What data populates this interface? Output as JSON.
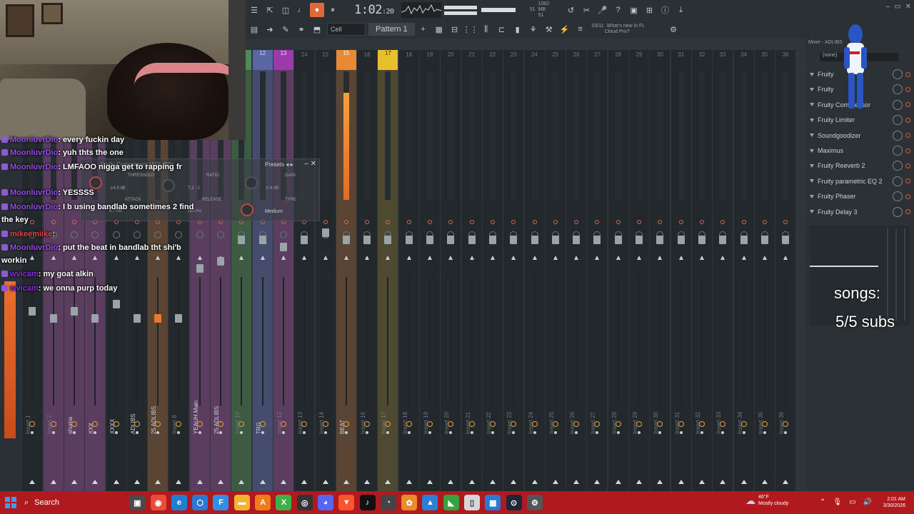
{
  "toolbar": {
    "time": "1:02",
    "time_small": ":20",
    "time_label": "M:S:CS",
    "cpu": "51",
    "ram": "1082 MB",
    "ram2": "51",
    "snap_label": "Cell",
    "pattern": "Pattern 1",
    "news": [
      "What's new in FL",
      "Cloud Pro?"
    ],
    "news_date": "03/11"
  },
  "mixer": {
    "tracks": [
      {
        "num": "",
        "name": "Master",
        "color": "dark"
      },
      {
        "num": "1",
        "name": "Insert 1",
        "color": "dark"
      },
      {
        "num": "2",
        "name": "Insert 2",
        "color": "purple"
      },
      {
        "num": "3",
        "name": "shuma",
        "color": "purple"
      },
      {
        "num": "4",
        "name": "XXX",
        "color": "purple"
      },
      {
        "num": "5",
        "name": "XXXX",
        "color": "dark"
      },
      {
        "num": "6",
        "name": "ADLIBS",
        "color": "dark"
      },
      {
        "num": "7",
        "name": "25 ADLIBS",
        "color": "orange"
      },
      {
        "num": "8",
        "name": "Insert 8",
        "color": "dark"
      },
      {
        "num": "9",
        "name": "YEAUH Main",
        "color": "purple"
      },
      {
        "num": "10",
        "name": "25 ADLIBS",
        "color": "purple"
      },
      {
        "num": "11",
        "name": "Insert 10",
        "color": "green"
      },
      {
        "num": "12",
        "name": "TRG",
        "color": "blue"
      },
      {
        "num": "13",
        "name": "Insert 12",
        "color": "purple"
      },
      {
        "num": "14",
        "name": "Insert 13",
        "color": "dark"
      },
      {
        "num": "15",
        "name": "Insert 14",
        "color": "dark"
      },
      {
        "num": "15",
        "name": "BEAT",
        "color": "orange"
      },
      {
        "num": "16",
        "name": "Insert 16",
        "color": "dark"
      },
      {
        "num": "17",
        "name": "Insert 17",
        "color": "gold"
      },
      {
        "num": "18",
        "name": "Insert 18",
        "color": "dark"
      },
      {
        "num": "19",
        "name": "Insert 19",
        "color": "dark"
      },
      {
        "num": "20",
        "name": "Insert 20",
        "color": "dark"
      },
      {
        "num": "21",
        "name": "Insert 21",
        "color": "dark"
      },
      {
        "num": "22",
        "name": "Insert 22",
        "color": "dark"
      },
      {
        "num": "23",
        "name": "Insert 23",
        "color": "dark"
      },
      {
        "num": "24",
        "name": "Insert 24",
        "color": "dark"
      },
      {
        "num": "25",
        "name": "Insert 25",
        "color": "dark"
      },
      {
        "num": "26",
        "name": "Insert 26",
        "color": "dark"
      },
      {
        "num": "27",
        "name": "Insert 27",
        "color": "dark"
      },
      {
        "num": "28",
        "name": "Insert 28",
        "color": "dark"
      },
      {
        "num": "29",
        "name": "Insert 29",
        "color": "dark"
      },
      {
        "num": "30",
        "name": "Insert 30",
        "color": "dark"
      },
      {
        "num": "31",
        "name": "Insert 31",
        "color": "dark"
      },
      {
        "num": "32",
        "name": "Insert 32",
        "color": "dark"
      },
      {
        "num": "33",
        "name": "Insert 33",
        "color": "dark"
      },
      {
        "num": "34",
        "name": "Insert 34",
        "color": "dark"
      },
      {
        "num": "35",
        "name": "Insert 35",
        "color": "dark"
      },
      {
        "num": "36",
        "name": "Insert 36",
        "color": "dark"
      }
    ]
  },
  "plugin": {
    "title": "Fruity Compressor (ADLIBS)",
    "presets": "Presets",
    "threshold_label": "THRESHOLD",
    "threshold_val": "-14.9 dB",
    "ratio_label": "RATIO",
    "ratio_val": "7.3 : 1",
    "gain_label": "GAIN",
    "gain_val": "0.4 dB",
    "attack_label": "ATTACK",
    "attack_val": "6.7 ms",
    "release_label": "RELEASE",
    "release_val": "110 ms",
    "type_label": "TYPE",
    "type_val": "Medium"
  },
  "chat": [
    {
      "user": "MoonluvrDio",
      "color": "purple",
      "msg": ": every fuckin day"
    },
    {
      "user": "MoonluvrDio",
      "color": "purple",
      "msg": ": yuh thts the one"
    },
    {
      "user": "MoonluvrDio",
      "color": "purple",
      "msg": ": LMFAOO nigga get to rapping fr"
    },
    {
      "user": "MoonluvrDio",
      "color": "purple",
      "msg": ": YESSSS"
    },
    {
      "user": "MoonluvrDio",
      "color": "purple",
      "msg": ": I b using bandlab sometimes 2 find"
    },
    {
      "user": "",
      "color": "purple",
      "msg": "the key"
    },
    {
      "user": "mikeemiike",
      "color": "red",
      "msg": ":"
    },
    {
      "user": "MoonluvrDio",
      "color": "purple",
      "msg": ": put the beat in bandlab tht shi'b"
    },
    {
      "user": "",
      "color": "purple",
      "msg": "workin"
    },
    {
      "user": "wvicam",
      "color": "violet",
      "msg": ": my goat alkin"
    },
    {
      "user": "wvicam",
      "color": "violet",
      "msg": ": we onna purp today"
    }
  ],
  "rpanel": {
    "title": "Mixer - ADLIBS",
    "selector": "(none)",
    "slots": [
      "Fruity",
      "Fruity",
      "Fruity Compressor",
      "Fruity Limiter",
      "Soundgoodizer",
      "Maximus",
      "Fruity Reeverb 2",
      "Fruity parametric EQ 2",
      "Fruity Phaser",
      "Fruity Delay 3"
    ]
  },
  "overlay": {
    "songs": "songs:",
    "subs": "5/5 subs"
  },
  "taskbar": {
    "search": "Search",
    "temp": "46°F",
    "weather": "Mostly cloudy",
    "time": "2:01 AM",
    "date": "3/30/2026"
  },
  "colors": {
    "taskbar": "#b01a1e",
    "accent": "#e0693a"
  }
}
